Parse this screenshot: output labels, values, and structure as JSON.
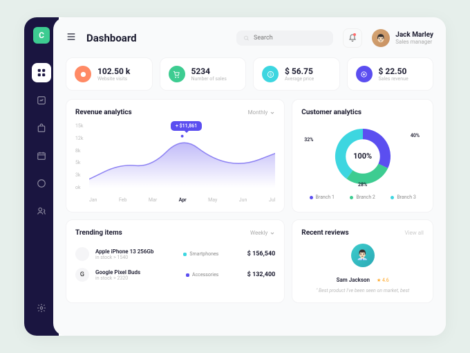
{
  "header": {
    "title": "Dashboard",
    "search_placeholder": "Search",
    "user": {
      "name": "Jack Marley",
      "role": "Sales manager"
    }
  },
  "stats": [
    {
      "icon": "target",
      "color": "#ff8a65",
      "value": "102.50 k",
      "label": "Website visits"
    },
    {
      "icon": "cart",
      "color": "#3dcc91",
      "value": "5234",
      "label": "Number of sales"
    },
    {
      "icon": "tag",
      "color": "#3dd6e0",
      "value": "$ 56.75",
      "label": "Average price"
    },
    {
      "icon": "coin",
      "color": "#5b4ef0",
      "value": "$ 22.50",
      "label": "Sales revenue"
    }
  ],
  "revenue": {
    "title": "Revenue analytics",
    "filter": "Monthly",
    "tooltip": "+ $11,861",
    "chart_data": {
      "type": "area",
      "categories": [
        "Jan",
        "Feb",
        "Mar",
        "Apr",
        "May",
        "Jun",
        "Jul"
      ],
      "values": [
        2000,
        5500,
        4800,
        12000,
        6500,
        5200,
        8000
      ],
      "yticks": [
        "15k",
        "12k",
        "8k",
        "5k",
        "3k",
        "ok"
      ],
      "ylim": [
        0,
        15000
      ],
      "highlight": "Apr"
    }
  },
  "customers": {
    "title": "Customer analytics",
    "center": "100%",
    "chart_data": {
      "type": "donut",
      "series": [
        {
          "name": "Branch 1",
          "value": 32,
          "color": "#5b4ef0"
        },
        {
          "name": "Branch 2",
          "value": 28,
          "color": "#3dcc91"
        },
        {
          "name": "Branch 3",
          "value": 40,
          "color": "#3dd6e0"
        }
      ]
    }
  },
  "trending": {
    "title": "Trending items",
    "filter": "Weekly",
    "items": [
      {
        "icon": "",
        "name": "Apple iPhone 13 256Gb",
        "stock": "in stock > 1540",
        "category": "Smartphones",
        "cat_color": "#3dd6e0",
        "price": "$ 156,540"
      },
      {
        "icon": "G",
        "name": "Google Pixel Buds",
        "stock": "in stock > 2320",
        "category": "Accessories",
        "cat_color": "#5b4ef0",
        "price": "$ 132,400"
      }
    ]
  },
  "reviews": {
    "title": "Recent reviews",
    "view_all": "View all",
    "name": "Sam Jackson",
    "rating": "★ 4.6",
    "text": "\" Best product I've been seen on market, best"
  }
}
